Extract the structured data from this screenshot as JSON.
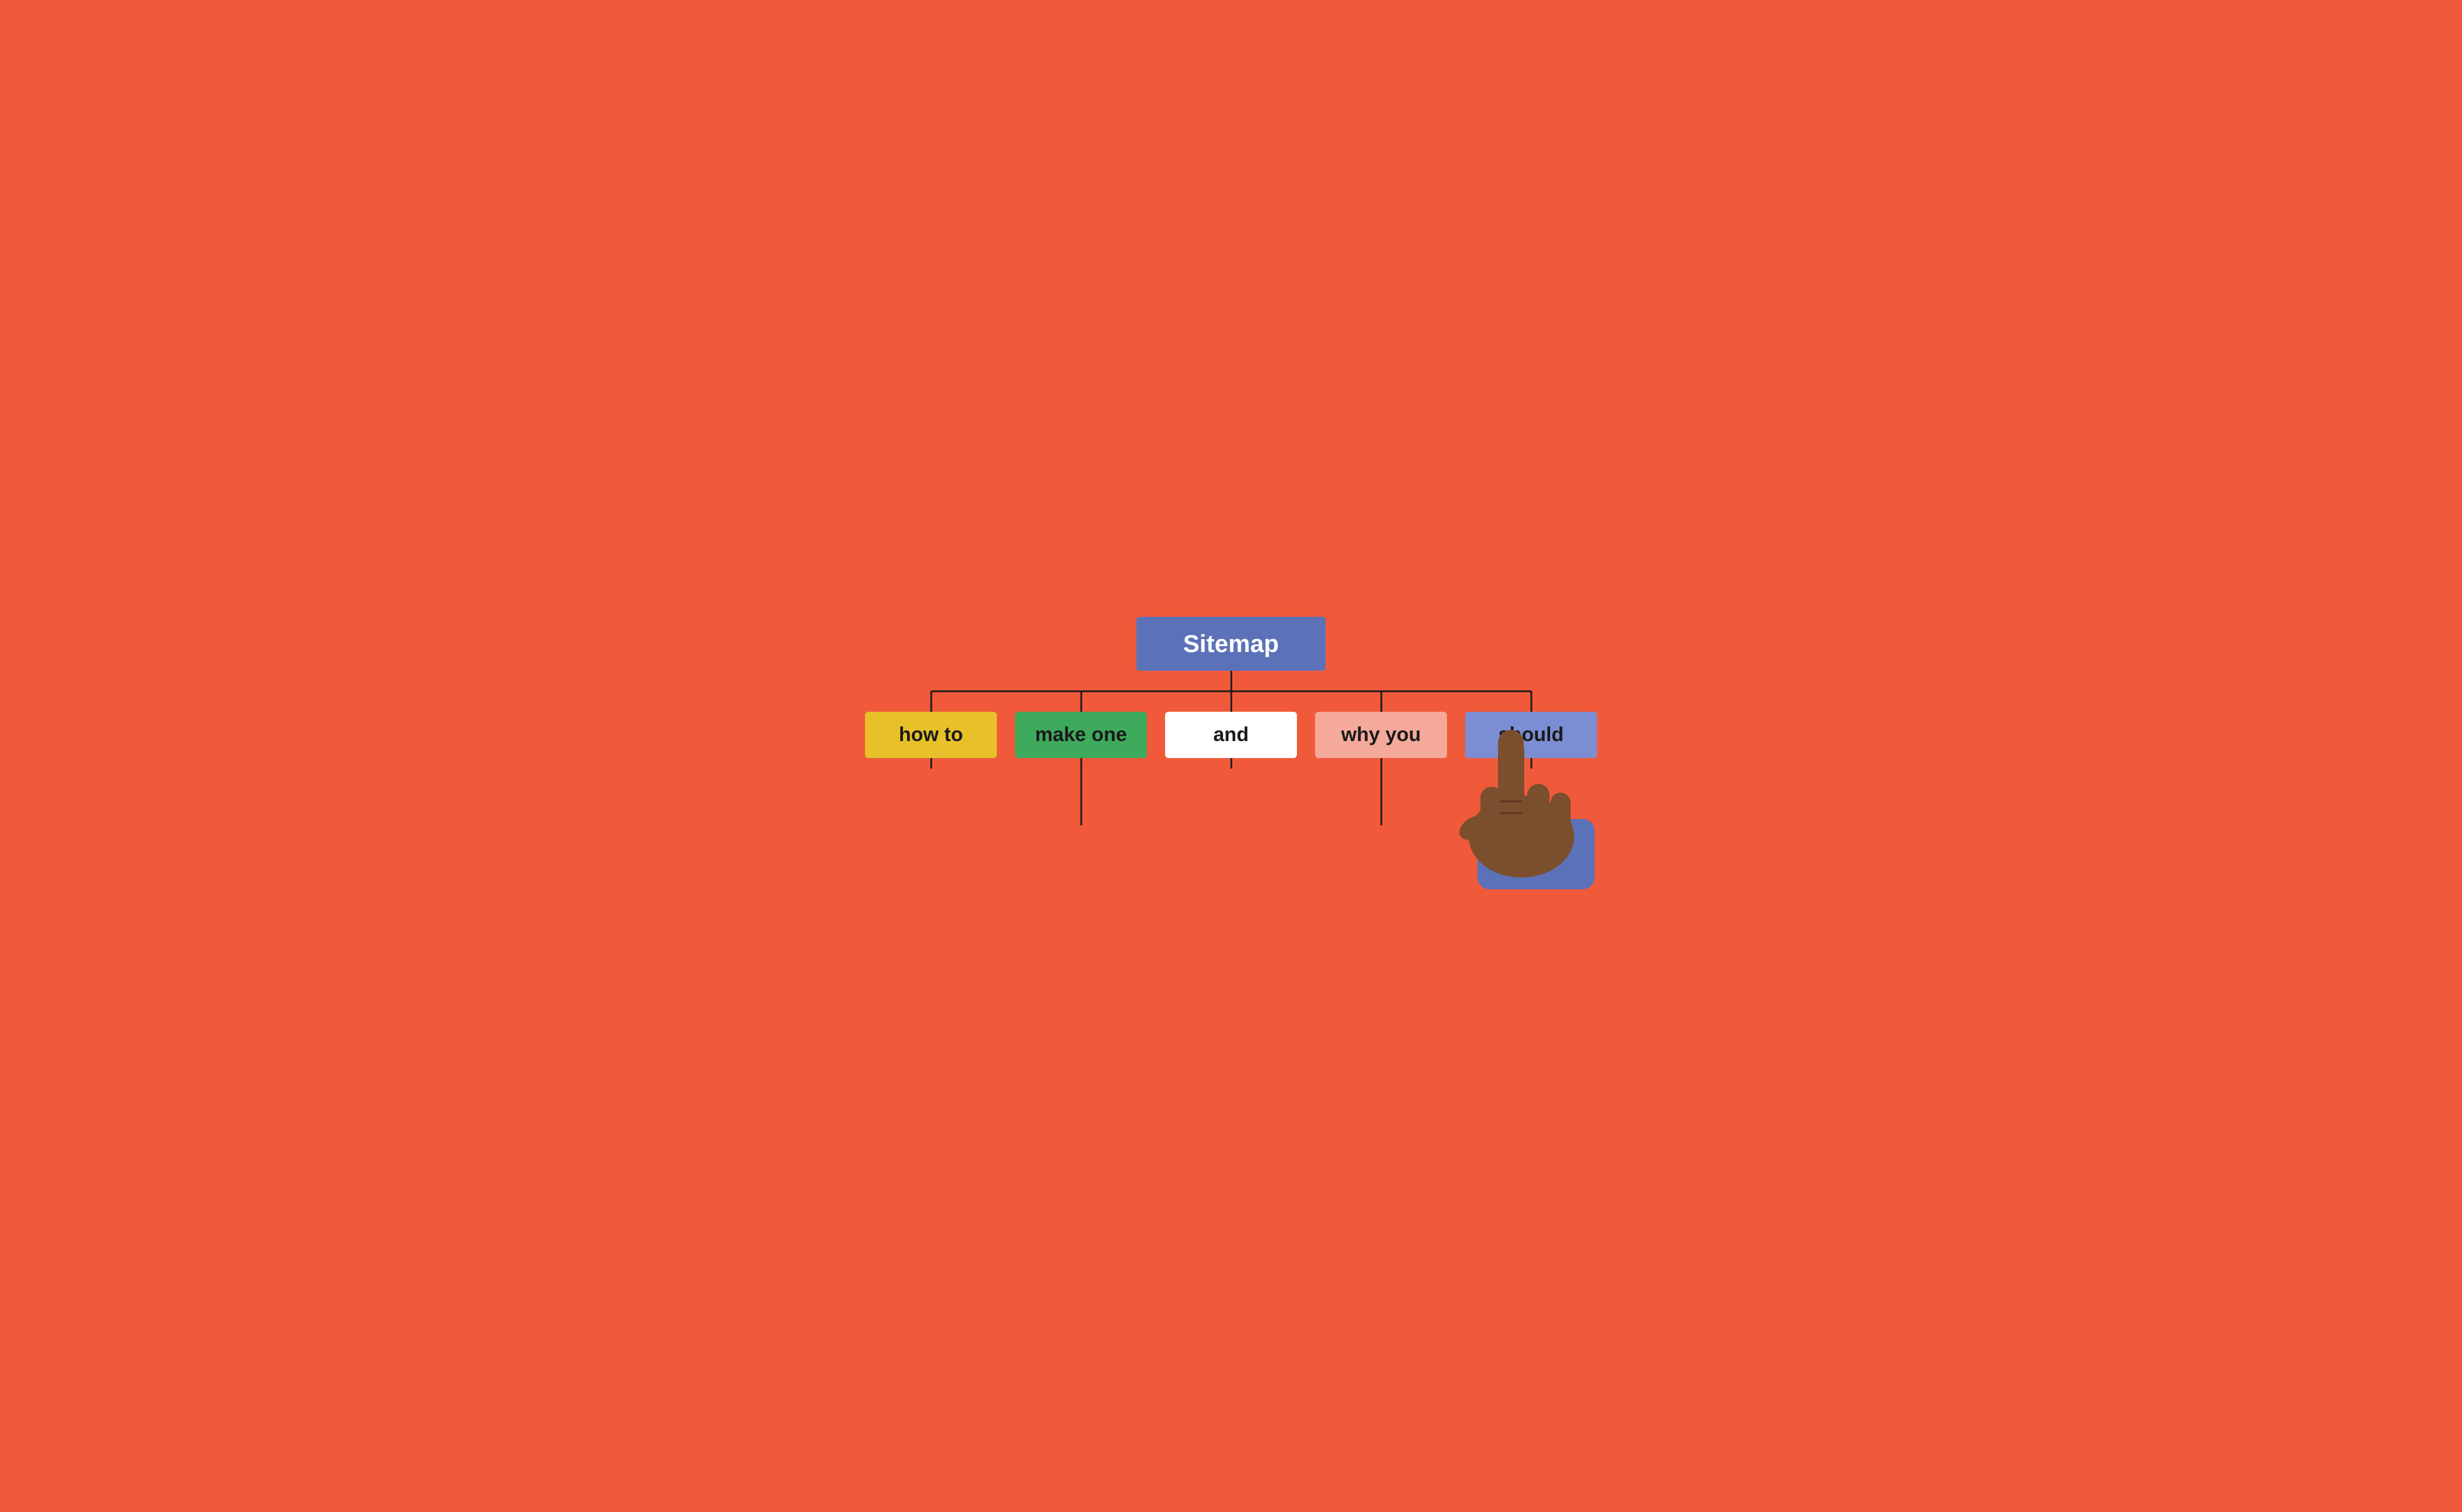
{
  "root": {
    "label": "Sitemap"
  },
  "children": [
    {
      "id": "how-to",
      "label": "how to",
      "color_main": "yellow-main",
      "color_sub": "yellow-sub",
      "sub_count": 1
    },
    {
      "id": "make-one",
      "label": "make one",
      "color_main": "green-main",
      "color_sub": "green-sub",
      "sub_count": 2
    },
    {
      "id": "and",
      "label": "and",
      "color_main": "white-main",
      "color_sub": "white-sub",
      "sub_count": 1
    },
    {
      "id": "why-you",
      "label": "why you",
      "color_main": "pink-main",
      "color_sub": "pink-sub",
      "sub_count": 2
    },
    {
      "id": "should",
      "label": "should",
      "color_main": "blue-main",
      "color_sub": "blue-sub",
      "sub_count": 1
    }
  ],
  "hand": {
    "visible": true
  }
}
